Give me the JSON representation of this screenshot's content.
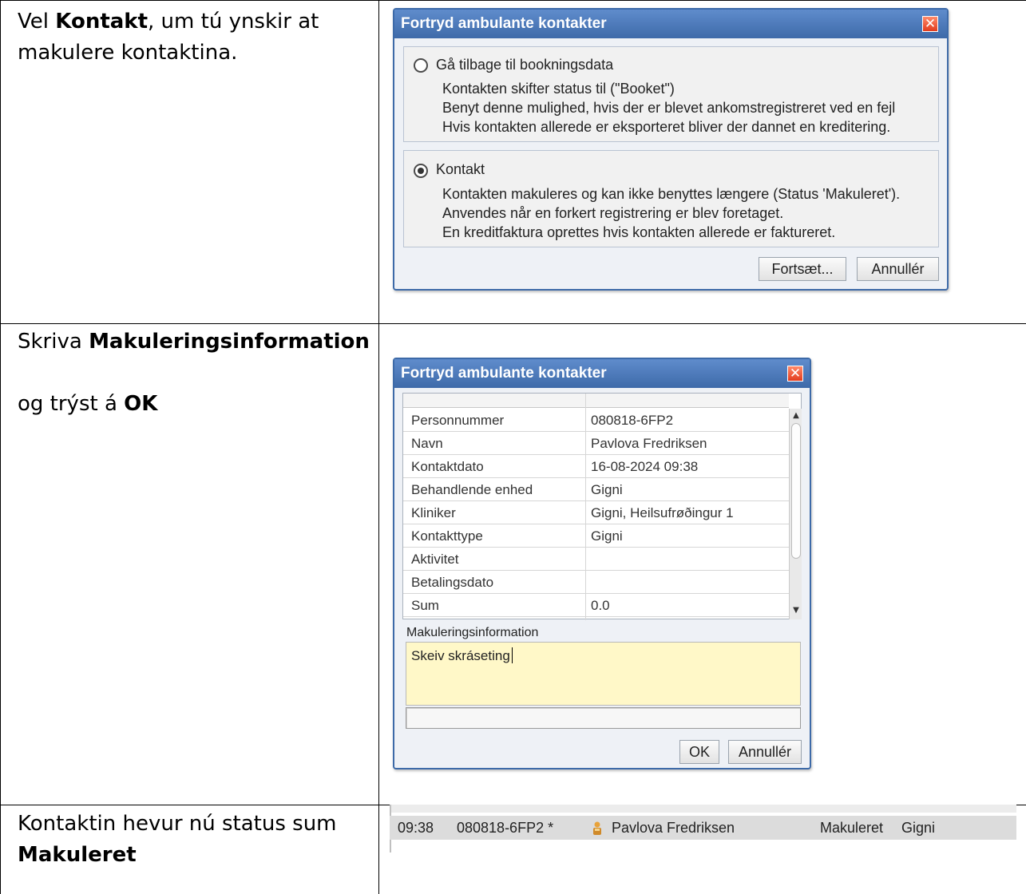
{
  "rows": [
    {
      "instruction_pre": "Vel ",
      "instruction_bold": "Kontakt",
      "instruction_post_line1": ", um tú ynskir at",
      "instruction_line2": "makulere kontaktina."
    },
    {
      "instruction_pre": "Skriva ",
      "instruction_bold": "Makuleringsinformation",
      "instruction2_pre": "og trýst á ",
      "instruction2_bold": "OK"
    },
    {
      "instruction_line1": "Kontaktin hevur nú status sum",
      "instruction_bold": "Makuleret"
    }
  ],
  "dialog1": {
    "title": "Fortryd ambulante kontakter",
    "close_symbol": "✕",
    "option1": {
      "label": "Gå tilbage til booknings­data",
      "selected": false,
      "lines": [
        "Kontakten skifter status til  (\"Booket\")",
        "Benyt denne mulighed, hvis der er blevet ankomstregistreret ved en fejl",
        "Hvis kontakten allerede er eksporteret bliver der dannet en kreditering."
      ]
    },
    "option2": {
      "label": "Kontakt",
      "selected": true,
      "lines": [
        "Kontakten makuleres og kan ikke benyttes længere (Status 'Makuleret').",
        "Anvendes når en forkert registrering er blev foretaget.",
        "En kreditfaktura oprettes hvis kontakten allerede er faktureret."
      ]
    },
    "continue_button": "Fortsæt...",
    "cancel_button": "Annullér"
  },
  "dialog2": {
    "title": "Fortryd ambulante kontakter",
    "close_symbol": "✕",
    "fields": [
      {
        "key": "Personnummer",
        "value": "080818-6FP2"
      },
      {
        "key": "Navn",
        "value": "Pavlova Fredriksen"
      },
      {
        "key": "Kontaktdato",
        "value": "16-08-2024 09:38"
      },
      {
        "key": "Behandlende enhed",
        "value": "Gigni"
      },
      {
        "key": "Kliniker",
        "value": "Gigni, Heilsufrøðingur 1"
      },
      {
        "key": "Kontakttype",
        "value": "Gigni"
      },
      {
        "key": "Aktivitet",
        "value": ""
      },
      {
        "key": "Betalingsdato",
        "value": ""
      },
      {
        "key": "Sum",
        "value": "0.0"
      }
    ],
    "scroll_up": "▲",
    "scroll_down": "▼",
    "makulering_label": "Makuleringsinformation",
    "makulering_text": "Skeiv skráseting",
    "ok_button": "OK",
    "cancel_button": "Annullér"
  },
  "status_list": {
    "row": {
      "time": "09:38",
      "personnummer": "080818-6FP2 *",
      "name": "Pavlova Fredriksen",
      "status": "Makuleret",
      "unit": "Gigni"
    }
  }
}
